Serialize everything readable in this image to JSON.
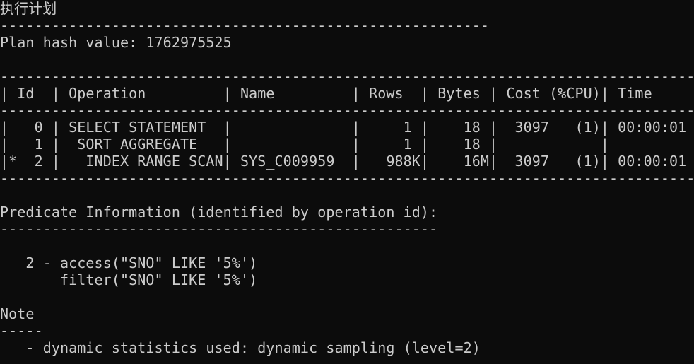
{
  "title": "执行计划",
  "plan_hash_line": "Plan hash value: 1762975525",
  "plan_table": {
    "top_border": "-----------------------------------------------------------------------------------",
    "header_separator": "-----------------------------------------------------------------------------------",
    "bottom_border": "-----------------------------------------------------------------------------------",
    "header": "| Id  | Operation         | Name         | Rows  | Bytes | Cost (%CPU)| Time     |",
    "rows": [
      "|   0 | SELECT STATEMENT  |              |     1 |    18 |  3097   (1)| 00:00:01 |",
      "|   1 |  SORT AGGREGATE   |              |     1 |    18 |            |          |",
      "|*  2 |   INDEX RANGE SCAN| SYS_C009959  |   988K|    16M|  3097   (1)| 00:00:01 |"
    ]
  },
  "dashes_plan_hash": "---------------------------------------------------------",
  "predicate": {
    "heading": "Predicate Information (identified by operation id):",
    "underline": "---------------------------------------------------",
    "lines": [
      "   2 - access(\"SNO\" LIKE '5%')",
      "       filter(\"SNO\" LIKE '5%')"
    ]
  },
  "note": {
    "heading": "Note",
    "underline": "-----",
    "text": "   - dynamic statistics used: dynamic sampling (level=2)"
  }
}
